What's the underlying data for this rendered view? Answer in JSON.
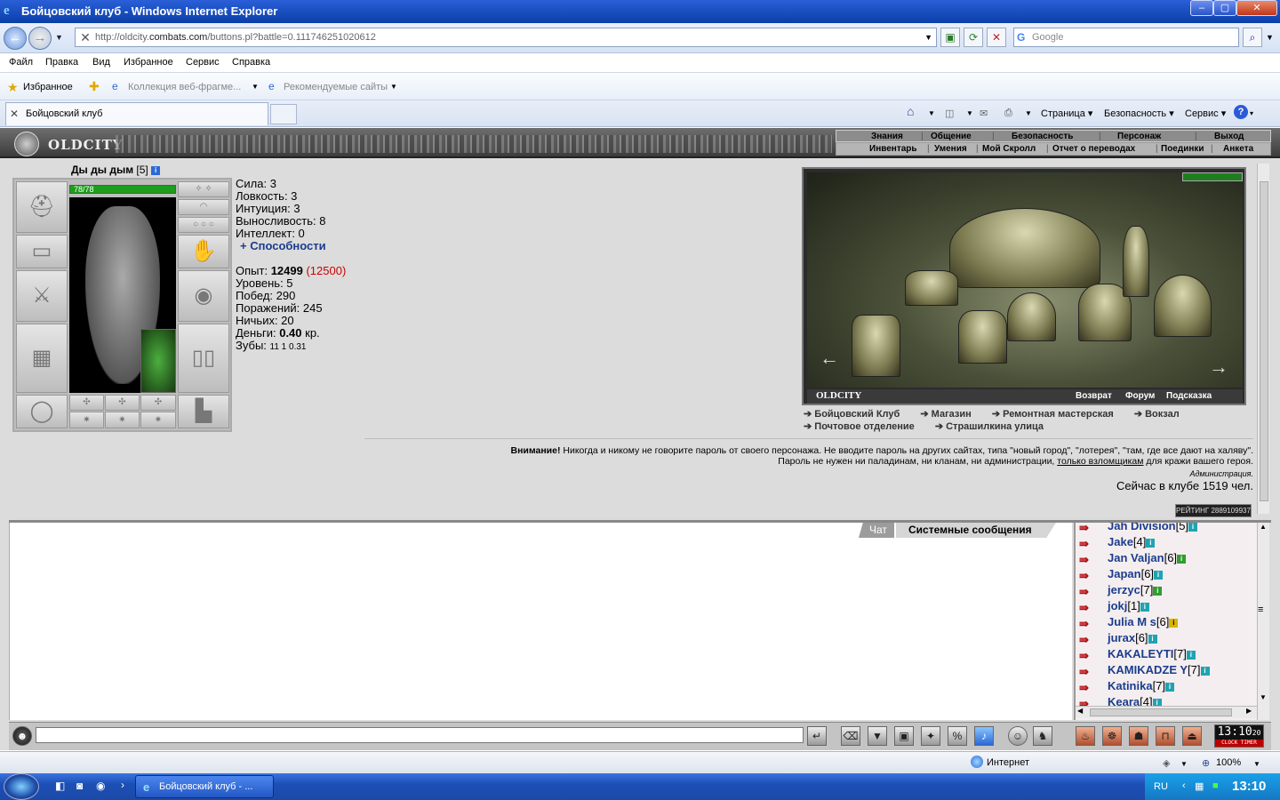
{
  "window": {
    "title": "Бойцовский клуб - Windows Internet Explorer",
    "minimize": "–",
    "maximize": "▢",
    "close": "✕"
  },
  "browser": {
    "url_prefix": "http://oldcity.",
    "url_domain": "combats.com",
    "url_path": "/buttons.pl?battle=0.111746251020612",
    "search_placeholder": "Google",
    "menu": [
      "Файл",
      "Правка",
      "Вид",
      "Избранное",
      "Сервис",
      "Справка"
    ],
    "favorites_label": "Избранное",
    "fav_link1": "Коллекция веб-фрагме...",
    "fav_link2": "Рекомендуемые сайты",
    "tab_title": "Бойцовский клуб",
    "commands": [
      "Страница",
      "Безопасность",
      "Сервис"
    ]
  },
  "game": {
    "logo": "OLDCITY",
    "nav_top": [
      "Знания",
      "Общение",
      "Безопасность",
      "Персонаж",
      "Выход"
    ],
    "nav_bottom": [
      "Инвентарь",
      "Умения",
      "Мой Скролл",
      "Отчет о переводах",
      "Поединки",
      "Анкета"
    ],
    "character": {
      "name": "Ды ды дым",
      "level": "[5]",
      "hp": "78/78",
      "hp_fraction": 1.0
    },
    "stats": {
      "strength": "Сила: 3",
      "agility": "Ловкость: 3",
      "intuition": "Интуиция: 3",
      "endurance": "Выносливость: 8",
      "intellect": "Интеллект: 0",
      "abilities": "+ Способности",
      "exp_label": "Опыт: ",
      "exp_value": "12499",
      "exp_next": "(12500)",
      "level_line": "Уровень: 5",
      "wins": "Побед: 290",
      "losses": "Поражений: 245",
      "draws": "Ничьих: 20",
      "money_label": "Деньги: ",
      "money_value": "0.40",
      "money_unit": " кр.",
      "teeth_label": "Зубы: ",
      "teeth_values": "11 1 0.31"
    },
    "city": {
      "name": "OLDCITY",
      "links_right": [
        "Возврат",
        "Форум",
        "Подсказка"
      ],
      "locations": [
        "Бойцовский Клуб",
        "Магазин",
        "Ремонтная мастерская",
        "Вокзал",
        "Почтовое отделение",
        "Страшилкина улица"
      ]
    },
    "warning": {
      "bold": "Внимание!",
      "line1": " Никогда и никому не говорите пароль от своего персонажа. Не вводите пароль на других сайтах, типа \"новый город\", \"лотерея\", \"там, где все дают на халяву\".",
      "line2_a": "Пароль не нужен ни паладинам, ни кланам, ни администрации, ",
      "line2_link": "только взломщикам",
      "line2_b": " для кражи вашего героя.",
      "signature": "Администрация."
    },
    "online": "Сейчас в клубе 1519 чел.",
    "rating_badge": "РЕЙТИНГ 2889109937",
    "chat_tabs": [
      "Чат",
      "Системные сообщения"
    ],
    "users": [
      {
        "name": "Jah Division",
        "level": "[5]",
        "badge": "teal"
      },
      {
        "name": "Jake",
        "level": "[4]",
        "badge": "teal"
      },
      {
        "name": "Jan Valjan",
        "level": "[6]",
        "badge": "green"
      },
      {
        "name": "Japan",
        "level": "[6]",
        "badge": "teal"
      },
      {
        "name": "jerzyc",
        "level": "[7]",
        "badge": "green"
      },
      {
        "name": "jokj",
        "level": "[1]",
        "badge": "teal"
      },
      {
        "name": "Julia M s",
        "level": "[6]",
        "badge": "yellow"
      },
      {
        "name": "jurax",
        "level": "[6]",
        "badge": "teal"
      },
      {
        "name": "KAKALEYTI",
        "level": "[7]",
        "badge": "teal"
      },
      {
        "name": "KAMIKADZE Y",
        "level": "[7]",
        "badge": "teal"
      },
      {
        "name": "Katinika",
        "level": "[7]",
        "badge": "teal"
      },
      {
        "name": "Keara",
        "level": "[4]",
        "badge": "teal"
      }
    ],
    "clock": "13:10",
    "clock_seconds": "20",
    "clock_labels": "CLOCK TIMER"
  },
  "status": {
    "zone": "Интернет",
    "zoom": "100%"
  },
  "taskbar": {
    "item": "Бойцовский клуб - ...",
    "lang": "RU",
    "time": "13:10"
  }
}
